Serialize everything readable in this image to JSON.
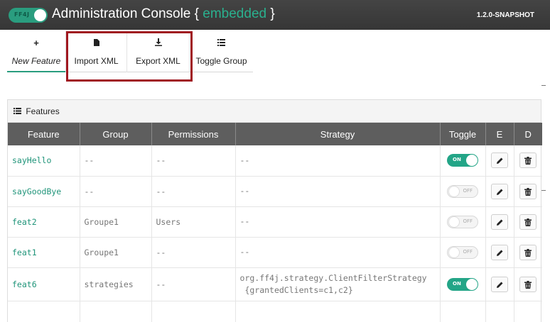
{
  "header": {
    "logo_text": "FF4J",
    "title_prefix": "Administration Console {",
    "title_env": " embedded ",
    "title_suffix": "}",
    "version": "1.2.0-SNAPSHOT"
  },
  "toolbar": {
    "items": [
      {
        "label": "New Feature",
        "icon": "plus-icon",
        "glyph": "+"
      },
      {
        "label": "Import XML",
        "icon": "file-icon",
        "glyph": "▮"
      },
      {
        "label": "Export XML",
        "icon": "download-icon",
        "glyph": "⤓"
      },
      {
        "label": "Toggle Group",
        "icon": "list-icon",
        "glyph": "☰"
      }
    ]
  },
  "panel": {
    "title": "Features",
    "icon": "list-icon",
    "columns": [
      "Feature",
      "Group",
      "Permissions",
      "Strategy",
      "Toggle",
      "E",
      "D"
    ],
    "rows": [
      {
        "feature": "sayHello",
        "group": "--",
        "permissions": "--",
        "strategy": "--",
        "strategy2": "",
        "toggle": "ON",
        "enabled": true
      },
      {
        "feature": "sayGoodBye",
        "group": "--",
        "permissions": "--",
        "strategy": "--",
        "strategy2": "",
        "toggle": "OFF",
        "enabled": false
      },
      {
        "feature": "feat2",
        "group": "Groupe1",
        "permissions": "Users",
        "strategy": "--",
        "strategy2": "",
        "toggle": "OFF",
        "enabled": false
      },
      {
        "feature": "feat1",
        "group": "Groupe1",
        "permissions": "--",
        "strategy": "--",
        "strategy2": "",
        "toggle": "OFF",
        "enabled": false
      },
      {
        "feature": "feat6",
        "group": "strategies",
        "permissions": "--",
        "strategy": "org.ff4j.strategy.ClientFilterStrategy",
        "strategy2": " {grantedClients=c1,c2}",
        "toggle": "ON",
        "enabled": true
      }
    ]
  },
  "colors": {
    "accent": "#2a9d7f",
    "header_bg": "#3b3b3b",
    "table_header_bg": "#5e5e5e",
    "highlight": "#a01820"
  }
}
